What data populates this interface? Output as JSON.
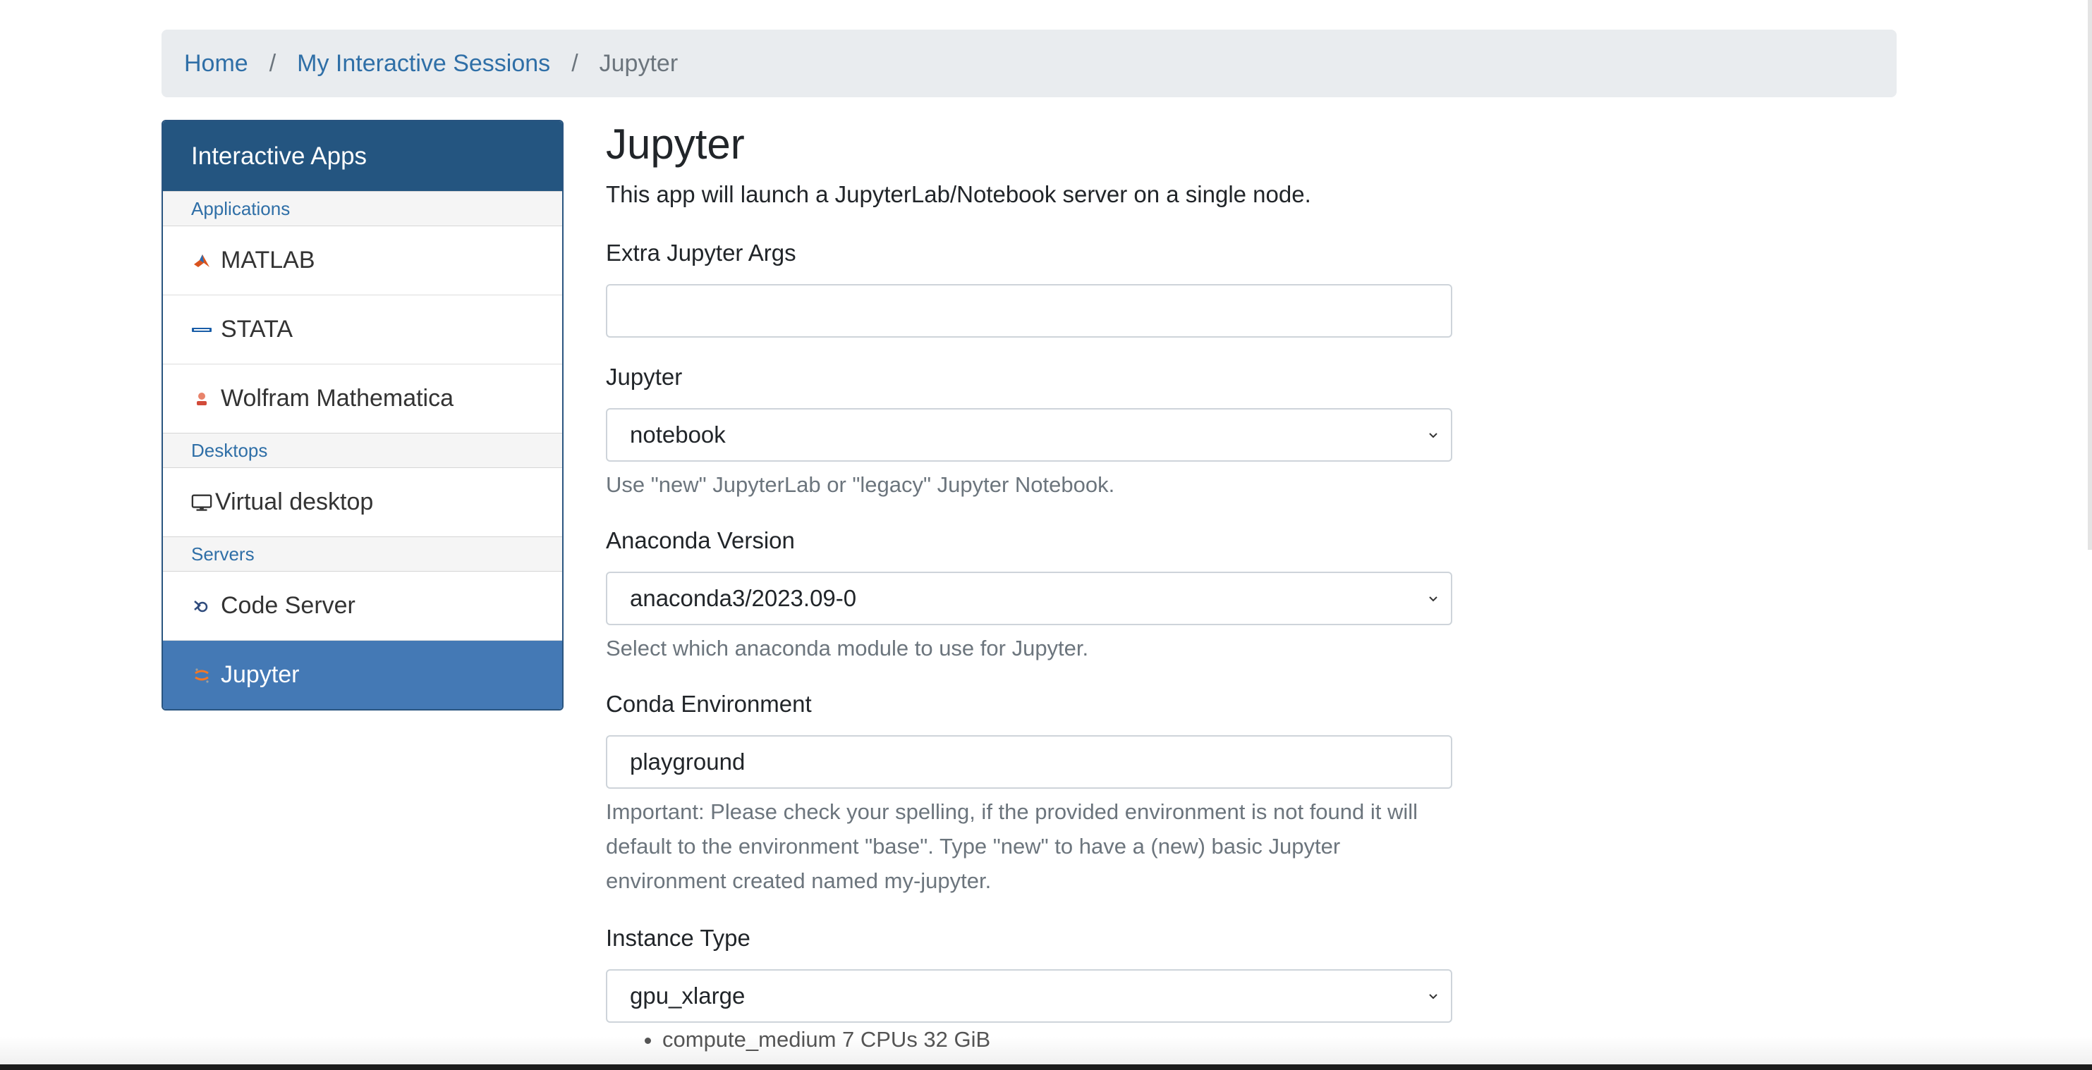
{
  "breadcrumb": {
    "home": "Home",
    "sep1": "/",
    "sessions": "My Interactive Sessions",
    "sep2": "/",
    "current": "Jupyter"
  },
  "sidebar": {
    "title": "Interactive Apps",
    "sections": {
      "applications": "Applications",
      "desktops": "Desktops",
      "servers": "Servers"
    },
    "items": {
      "matlab": {
        "label": "MATLAB",
        "icon": "matlab-icon"
      },
      "stata": {
        "label": "STATA",
        "icon": "stata-icon"
      },
      "mathematica": {
        "label": "Wolfram Mathematica",
        "icon": "mathematica-icon"
      },
      "virtual_desktop": {
        "label": "Virtual desktop",
        "icon": "monitor-icon"
      },
      "code_server": {
        "label": "Code Server",
        "icon": "code-server-icon"
      },
      "jupyter": {
        "label": "Jupyter",
        "icon": "jupyter-icon"
      }
    },
    "active": "Jupyter",
    "colors": {
      "header": "#245580",
      "active": "#4479b5",
      "section_text": "#2f6fa7"
    }
  },
  "main": {
    "title": "Jupyter",
    "description": "This app will launch a JupyterLab/Notebook server on a single node.",
    "fields": {
      "extra_args": {
        "label": "Extra Jupyter Args",
        "value": ""
      },
      "jupyter": {
        "label": "Jupyter",
        "value": "notebook",
        "help": "Use \"new\" JupyterLab or \"legacy\" Jupyter Notebook."
      },
      "anaconda": {
        "label": "Anaconda Version",
        "value": "anaconda3/2023.09-0",
        "help": "Select which anaconda module to use for Jupyter."
      },
      "conda_env": {
        "label": "Conda Environment",
        "value": "playground",
        "help": "Important: Please check your spelling, if the provided environment is not found it will default to the environment \"base\". Type \"new\" to have a (new) basic Jupyter environment created named my-jupyter."
      },
      "instance_type": {
        "label": "Instance Type",
        "value": "gpu_xlarge",
        "options_shown": [
          "compute_medium 7 CPUs 32 GiB"
        ]
      }
    }
  }
}
